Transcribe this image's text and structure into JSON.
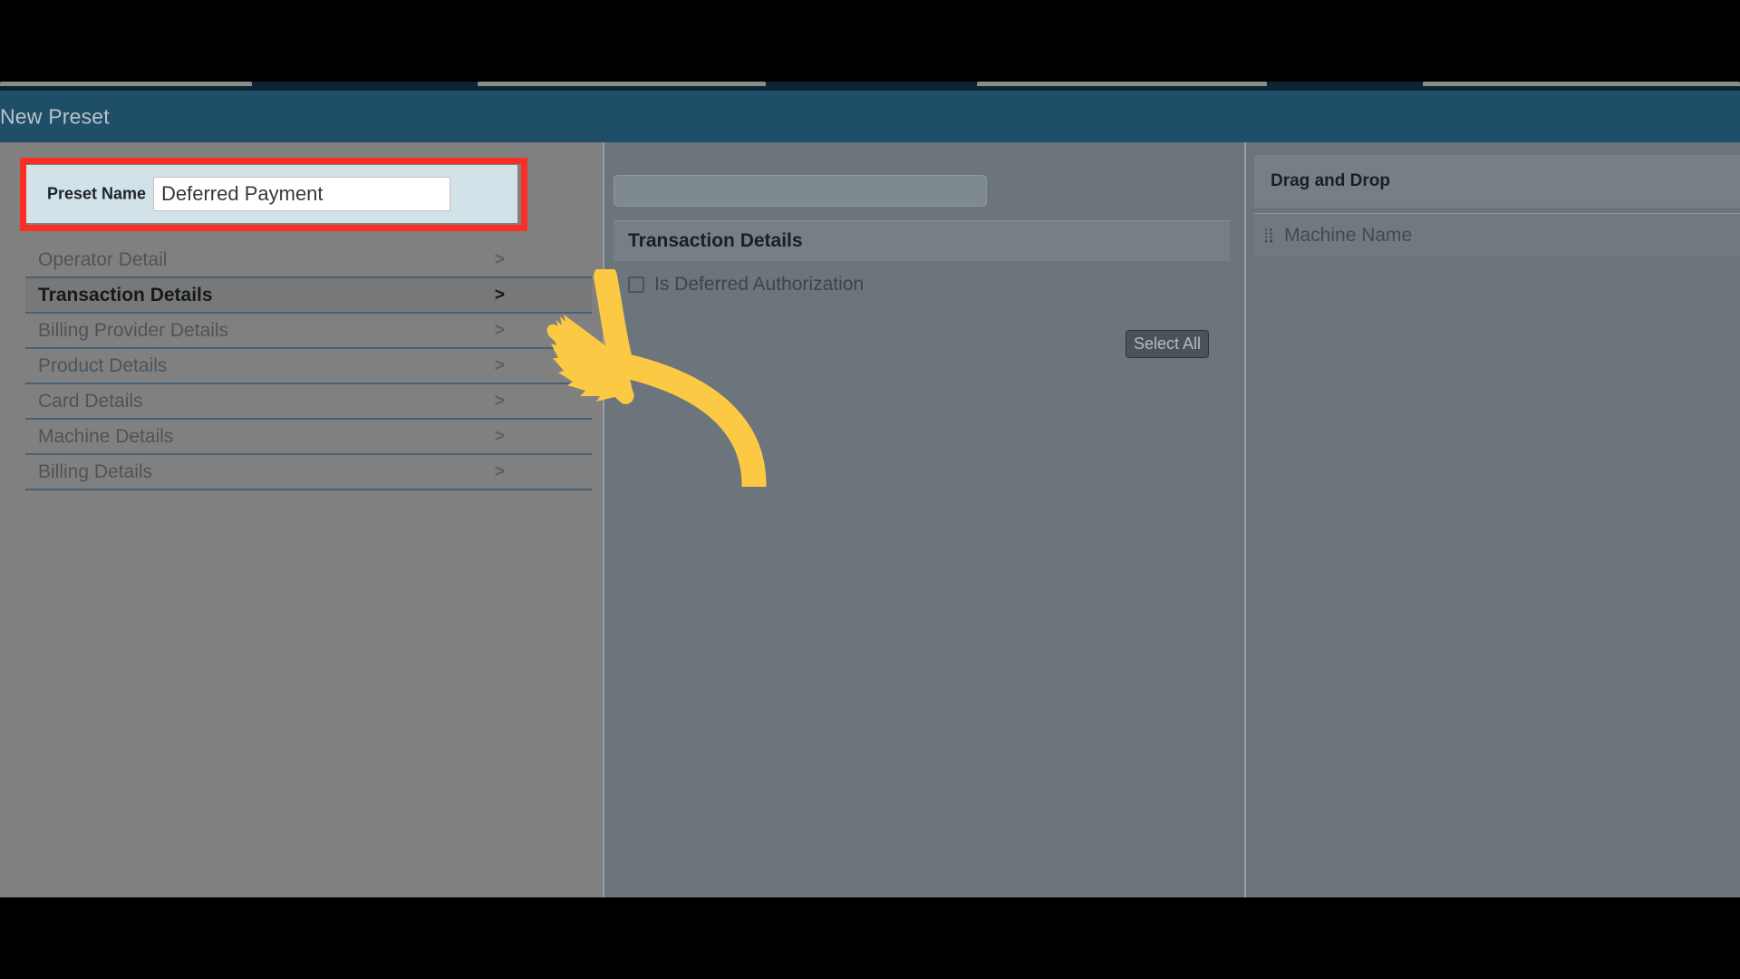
{
  "window": {
    "title": "New Preset",
    "title_bar_color": "#1f4e68",
    "body_color": "#808080"
  },
  "tabs": [
    {
      "name": "tab-stub-1"
    },
    {
      "name": "tab-stub-2"
    },
    {
      "name": "tab-stub-3"
    },
    {
      "name": "tab-stub-4"
    }
  ],
  "preset_form": {
    "label": "Preset Name",
    "value": "Deferred Payment",
    "placeholder": "",
    "highlight_color": "#fa2e23",
    "field_background": "#d2e2e9"
  },
  "categories": {
    "items": [
      {
        "label": "Operator Detail",
        "chevron": ">",
        "active": false
      },
      {
        "label": "Transaction Details",
        "chevron": ">",
        "active": true
      },
      {
        "label": "Billing Provider Details",
        "chevron": ">",
        "active": false
      },
      {
        "label": "Product Details",
        "chevron": ">",
        "active": false
      },
      {
        "label": "Card Details",
        "chevron": ">",
        "active": false
      },
      {
        "label": "Machine Details",
        "chevron": ">",
        "active": false
      },
      {
        "label": "Billing Details",
        "chevron": ">",
        "active": false
      }
    ]
  },
  "middle_panel": {
    "search_placeholder": "",
    "search_value": "",
    "select_all_label": "Select All",
    "header": "Transaction Details",
    "fields": [
      {
        "label": "Is Deferred Authorization",
        "checked": false
      }
    ]
  },
  "right_panel": {
    "header": "Drag and Drop",
    "items": [
      {
        "label": "Machine Name",
        "handle": "drag-grip-icon"
      }
    ]
  },
  "annotation": {
    "type": "curved-arrow",
    "color": "#fbc944",
    "points_to": "preset-name-field"
  }
}
